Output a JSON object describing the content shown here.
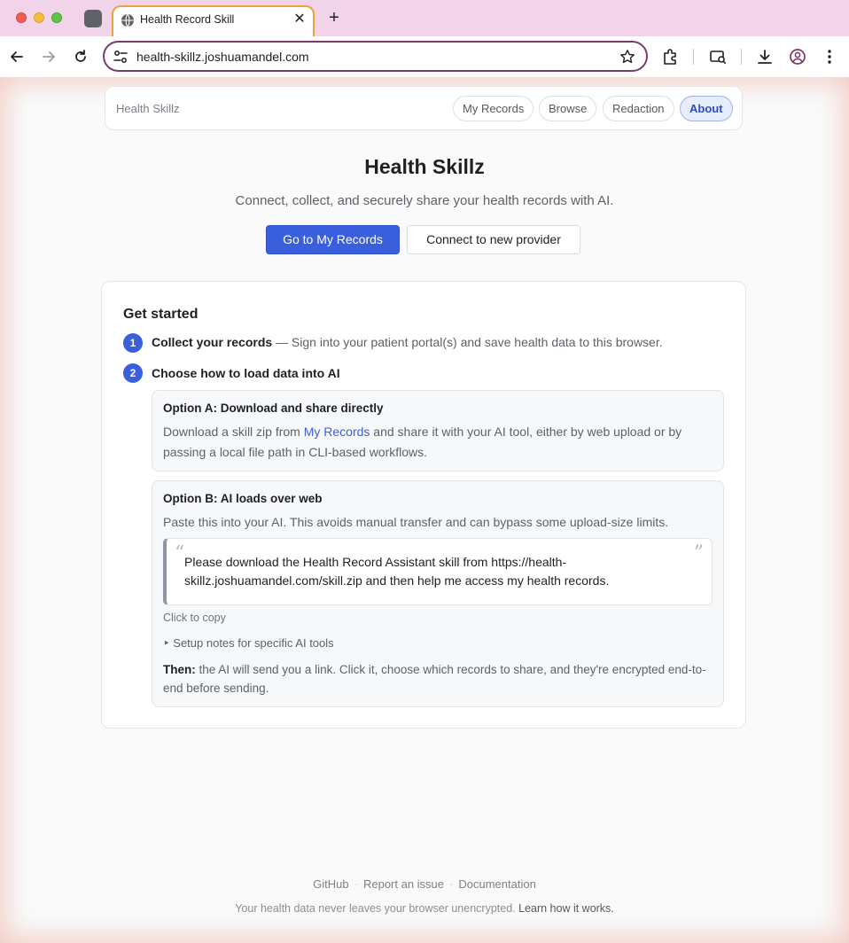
{
  "browser": {
    "tab_title": "Health Record Skill",
    "url": "health-skillz.joshuamandel.com"
  },
  "nav": {
    "brand": "Health Skillz",
    "items": [
      {
        "label": "My Records"
      },
      {
        "label": "Browse"
      },
      {
        "label": "Redaction"
      },
      {
        "label": "About",
        "active": true
      }
    ]
  },
  "hero": {
    "title": "Health Skillz",
    "subtitle": "Connect, collect, and securely share your health records with AI.",
    "primary_button": "Go to My Records",
    "secondary_button": "Connect to new provider"
  },
  "get_started": {
    "title": "Get started",
    "steps": [
      {
        "num": "1",
        "title": "Collect your records",
        "detail": " — Sign into your patient portal(s) and save health data to this browser."
      },
      {
        "num": "2",
        "title": "Choose how to load data into AI"
      }
    ],
    "option_a": {
      "title": "Option A: Download and share directly",
      "body_pre": "Download a skill zip from ",
      "link": "My Records",
      "body_post": " and share it with your AI tool, either by web upload or by passing a local file path in CLI-based workflows."
    },
    "option_b": {
      "title": "Option B: AI loads over web",
      "body": "Paste this into your AI. This avoids manual transfer and can bypass some upload-size limits.",
      "quote": "Please download the Health Record Assistant skill from https://health-skillz.joshuamandel.com/skill.zip and then help me access my health records.",
      "copy_hint": "Click to copy",
      "setup_notes": "‣ Setup notes for specific AI tools",
      "then_label": "Then:",
      "then_text": " the AI will send you a link. Click it, choose which records to share, and they're encrypted end-to-end before sending."
    }
  },
  "footer": {
    "links": [
      {
        "label": "GitHub"
      },
      {
        "label": "Report an issue"
      },
      {
        "label": "Documentation"
      }
    ],
    "separator": "·",
    "note": "Your health data never leaves your browser unencrypted. ",
    "learn_link": "Learn how it works."
  },
  "colors": {
    "accent": "#3a5fdd",
    "chrome_frame": "#f1d3ea",
    "tab_outline": "#e8a23d",
    "omnibox_outline": "#7b3a6a"
  }
}
